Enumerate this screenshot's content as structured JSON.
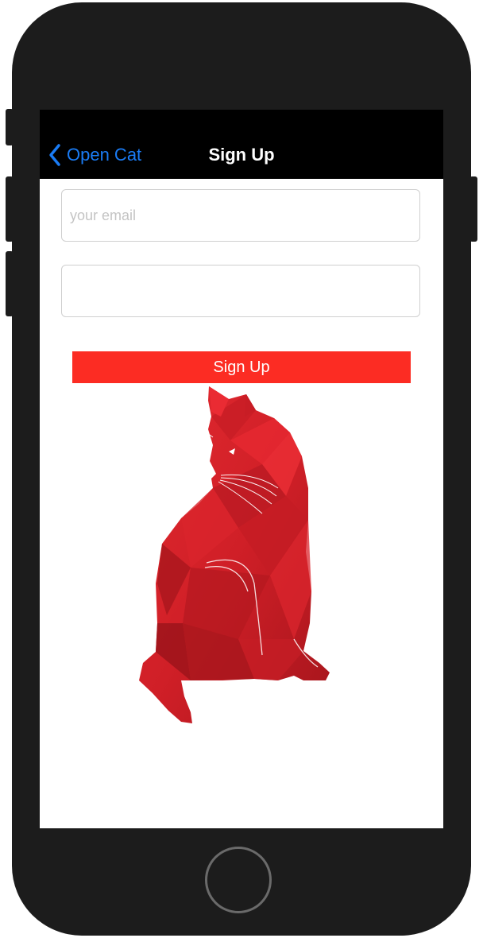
{
  "navbar": {
    "back_label": "Open Cat",
    "title": "Sign Up"
  },
  "form": {
    "email_placeholder": "your email",
    "email_value": "",
    "password_value": "",
    "submit_label": "Sign Up"
  },
  "colors": {
    "navbar_bg": "#000000",
    "back_link": "#1a7cf5",
    "submit_bg": "#fc2c23",
    "cat_red": "#d8222a"
  },
  "icons": {
    "back": "chevron-left-icon",
    "illustration": "cat-illustration"
  }
}
